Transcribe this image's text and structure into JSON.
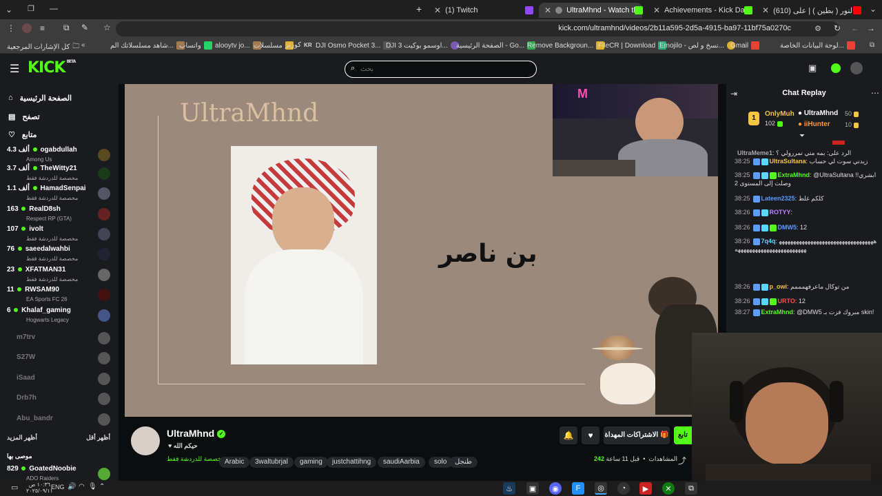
{
  "browser": {
    "tabs": [
      {
        "title": "(1) Twitch",
        "active": false
      },
      {
        "title": "UltraMhnd - Watch the VOD",
        "active": true
      },
      {
        "title": "Achievements - Kick Dashboard",
        "active": false
      },
      {
        "title": "(610) عروسة النور ( بطين ) | على",
        "active": false
      }
    ],
    "url": "kick.com/ultramhnd/videos/2b11a595-2d5a-4915-ba97-11bf75a0270c",
    "bookmarks": [
      "كل الإشارات المرجعية",
      "شاهد مسلسلاتك الم...",
      "واتساب",
      "alooytv jo...",
      "مسلسلات",
      "كورتر",
      "DJI Osmo Pocket 3...",
      "DJI اوسمو بوكيت 3...",
      "الصفحة الرئيسية - Go...",
      "Remove Backgroun...",
      "FileCR | Download",
      "Emojilo - نسخ و لص...",
      "Gmail",
      "لوحة البيانات الخاصة..."
    ]
  },
  "header": {
    "logo": "KICK",
    "logo_badge": "BETA",
    "search_placeholder": "بحث"
  },
  "sidebar": {
    "nav": [
      {
        "label": "الصفحة الرئيسية",
        "icon": "home-icon"
      },
      {
        "label": "تصفح",
        "icon": "browse-icon"
      },
      {
        "label": "متابع",
        "icon": "heart-icon"
      }
    ],
    "following": [
      {
        "name": "ogabdullah",
        "viewers": "4.3 ألف",
        "game": "Among Us",
        "live": true,
        "color": "#5a4a20"
      },
      {
        "name": "TheWitty21",
        "viewers": "3.7 ألف",
        "game": "مخصصة للدردشة فقط",
        "live": true,
        "color": "#1a3a1a"
      },
      {
        "name": "HamadSenpai",
        "viewers": "1.1 ألف",
        "game": "مخصصة للدردشة فقط",
        "live": true,
        "color": "#556"
      },
      {
        "name": "RealD8sh",
        "viewers": "163",
        "game": "Respect RP (GTA)",
        "live": true,
        "color": "#622"
      },
      {
        "name": "ivolt",
        "viewers": "107",
        "game": "مخصصة للدردشة فقط",
        "live": true,
        "color": "#445"
      },
      {
        "name": "saeedalwahbi",
        "viewers": "76",
        "game": "مخصصة للدردشة فقط",
        "live": true,
        "color": "#223"
      },
      {
        "name": "XFATMAN31",
        "viewers": "23",
        "game": "مخصصة للدردشة فقط",
        "live": true,
        "color": "#666"
      },
      {
        "name": "RWSAM90",
        "viewers": "11",
        "game": "EA Sports FC 26",
        "live": true,
        "color": "#411"
      },
      {
        "name": "Khalaf_gaming",
        "viewers": "6",
        "game": "Hogwarts Legacy",
        "live": true,
        "color": "#458"
      }
    ],
    "offline": [
      "m7trv",
      "S27W",
      "iSaad",
      "Drb7h",
      "Abu_bandr"
    ],
    "show_more": "أظهر المزيد",
    "show_less": "أظهر أقل",
    "recommended_title": "موصى بها",
    "recommended": [
      {
        "name": "GoatedNoobie",
        "viewers": "829",
        "game": "ADO Raiders",
        "color": "#5a3"
      }
    ]
  },
  "video": {
    "overlay_title": "UltraMhnd",
    "overlay_arabic": "بن ناصر"
  },
  "channel": {
    "name": "UltraMhnd",
    "subtitle": "حيكم الله",
    "category": "مخصصة للدردشة فقط",
    "tags": [
      "Arabic",
      "3waltubrjal",
      "gaming",
      "justchattihng",
      "saudiAarbia",
      "solo",
      "طنجل"
    ],
    "views_label": "المشاهدات",
    "views": "242",
    "time_ago": "قبل 11 ساعة",
    "follow_label": "تابع",
    "gift_label": "الاشتراكات المهداة"
  },
  "chat": {
    "title": "Chat Replay",
    "top_gifters": [
      {
        "rank": "1",
        "name": "OnlyMuh",
        "count": "102"
      },
      {
        "name": "UltraMhnd",
        "count": "50"
      },
      {
        "name": "iiHunter",
        "count": "10"
      }
    ],
    "messages": [
      {
        "time": "",
        "user": "UltraMeme1",
        "text": "الرد على: بمه متي تمررولي ؟",
        "color": "#aaa"
      },
      {
        "time": "38:25",
        "user": "UltraSultana",
        "text": "زيدني سوت لي حساب",
        "color": "#f5c542"
      },
      {
        "time": "38:25",
        "user": "ExtraMhnd",
        "text": "@UltraSultana ابشري!! وصلت إلى المستوى 2",
        "color": "#53fc18"
      },
      {
        "time": "38:25",
        "user": "Lateen2325",
        "text": "كلكم غلط",
        "color": "#5b9cff"
      },
      {
        "time": "38:26",
        "user": "ROTYY",
        "text": "",
        "color": "#c084fc"
      },
      {
        "time": "38:26",
        "user": "DMW5",
        "text": "12",
        "color": "#5b9cff"
      },
      {
        "time": "38:26",
        "user": "7q4q",
        "text": "ههههههههههههههههههههههههههههههههههههههههههههههههههههههههههه",
        "color": "#5bd6ff"
      },
      {
        "time": "38:26",
        "user": "p_owi",
        "text": "من توكال ماعرفهمممم",
        "color": "#f5c542"
      },
      {
        "time": "38:26",
        "user": "URTO",
        "text": "12",
        "color": "#ff4d4d"
      },
      {
        "time": "38:27",
        "user": "ExtraMhnd",
        "text": "@DMW5 مبروك فزت بـ skin!",
        "color": "#53fc18"
      }
    ]
  },
  "taskbar": {
    "lang": "ENG",
    "time": "١٠:٣٦ ص",
    "date": "٢٠٢٥/٠٩/١١"
  }
}
